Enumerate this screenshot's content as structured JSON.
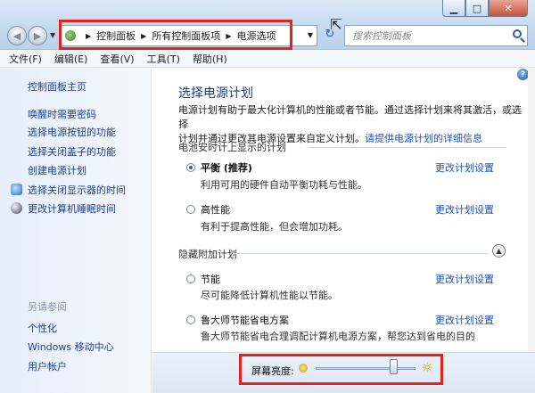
{
  "window": {
    "buttons": {
      "min": "▁",
      "max": "□",
      "close": "✕"
    }
  },
  "nav": {
    "back": "◀",
    "forward": "▶",
    "breadcrumbs": [
      "控制面板",
      "所有控制面板项",
      "电源选项"
    ],
    "refresh": "↻",
    "search_placeholder": "搜索控制面板"
  },
  "menu": [
    "文件(F)",
    "编辑(E)",
    "查看(V)",
    "工具(T)",
    "帮助(H)"
  ],
  "sidebar": {
    "home": "控制面板主页",
    "links": [
      "唤醒时需要密码",
      "选择电源按钮的功能",
      "选择关闭盖子的功能",
      "创建电源计划",
      "选择关闭显示器的时间",
      "更改计算机睡眠时间"
    ],
    "see_also_title": "另请参阅",
    "see_also": [
      "个性化",
      "Windows 移动中心",
      "用户帐户"
    ]
  },
  "main": {
    "title": "选择电源计划",
    "desc_line1": "电源计划有助于最大化计算机的性能或者节能。通过选择计划来将其激活，或选择",
    "desc_line2": "计划并通过更改其电源设置来自定义计划。",
    "desc_link": "请提供电源计划的详细信息",
    "battery_section": "电池安时计上显示的计划",
    "hidden_section": "隐藏附加计划",
    "change_link": "更改计划设置",
    "plans": [
      {
        "name": "平衡 (推荐)",
        "desc": "利用可用的硬件自动平衡功耗与性能。",
        "selected": true
      },
      {
        "name": "高性能",
        "desc": "有利于提高性能，但会增加功耗。",
        "selected": false
      },
      {
        "name": "节能",
        "desc": "尽可能降低计算机性能以节能。",
        "selected": false
      },
      {
        "name": "鲁大师节能省电方案",
        "desc": "鲁大师节能省电合理调配计算机电源方案，帮您达到省电的目的",
        "selected": false
      }
    ]
  },
  "brightness": {
    "label": "屏幕亮度:",
    "level": 0.78
  },
  "colors": {
    "highlight": "#e8211b",
    "link": "#1d52c2",
    "title": "#1e3b8a"
  },
  "icons": [
    "control-panel-icon",
    "search-icon",
    "help-icon",
    "monitor-icon",
    "moon-icon",
    "sun-icon"
  ]
}
